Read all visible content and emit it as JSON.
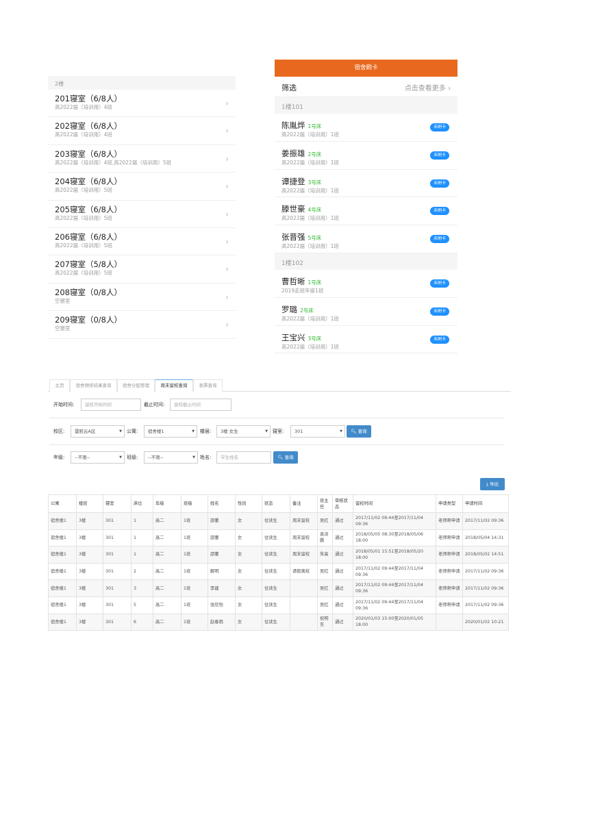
{
  "room_list": {
    "floor": "2楼",
    "rooms": [
      {
        "name": "201寝室（6/8人）",
        "sub": "高2022届（培训用）4班"
      },
      {
        "name": "202寝室（6/8人）",
        "sub": "高2022届（培训用）4班"
      },
      {
        "name": "203寝室（6/8人）",
        "sub": "高2022届（培训用）4班,高2022届（培训用）5班"
      },
      {
        "name": "204寝室（6/8人）",
        "sub": "高2022届（培训用）5班"
      },
      {
        "name": "205寝室（6/8人）",
        "sub": "高2022届（培训用）5班"
      },
      {
        "name": "206寝室（6/8人）",
        "sub": "高2022届（培训用）5班"
      },
      {
        "name": "207寝室（5/8人）",
        "sub": "高2022届（培训用）5班"
      },
      {
        "name": "208寝室（0/8人）",
        "sub": "空寝室"
      },
      {
        "name": "209寝室（0/8人）",
        "sub": "空寝室"
      }
    ]
  },
  "checkin": {
    "title": "宿舍刷卡",
    "filter_label": "筛选",
    "filter_more": "点击查看更多 ›",
    "groups": [
      {
        "name": "1楼101",
        "students": [
          {
            "name": "陈胤烨",
            "bed": "1号床",
            "sub": "高2022届（培训用）1班",
            "status": "未刷卡"
          },
          {
            "name": "姜振雄",
            "bed": "2号床",
            "sub": "高2022届（培训用）1班",
            "status": "未刷卡"
          },
          {
            "name": "谭捷登",
            "bed": "3号床",
            "sub": "高2022届（培训用）1班",
            "status": "未刷卡"
          },
          {
            "name": "滕世豪",
            "bed": "4号床",
            "sub": "高2022届（培训用）1班",
            "status": "未刷卡"
          },
          {
            "name": "张晋强",
            "bed": "5号床",
            "sub": "高2022届（培训用）1班",
            "status": "未刷卡"
          }
        ]
      },
      {
        "name": "1楼102",
        "students": [
          {
            "name": "曹哲晰",
            "bed": "1号床",
            "sub": "2019走班年级1班",
            "status": "未刷卡"
          },
          {
            "name": "罗璐",
            "bed": "2号床",
            "sub": "高2022届（培训用）1班",
            "status": "未刷卡"
          },
          {
            "name": "王宝兴",
            "bed": "3号床",
            "sub": "高2022届（培训用）1班",
            "status": "未刷卡"
          }
        ]
      }
    ]
  },
  "admin": {
    "tabs": [
      "主页",
      "宿舍预排结果查询",
      "宿舍分配管理",
      "周末留校查询",
      "表票查询"
    ],
    "active_tab": 3,
    "start_label": "开始时间:",
    "start_placeholder": "留校开始时间",
    "end_label": "截止时间:",
    "end_placeholder": "留校截止时间",
    "campus_label": "校区:",
    "campus_value": "雷鲛云A区",
    "apartment_label": "公寓:",
    "apartment_value": "宿舍楼1",
    "floor_label": "楼层:",
    "floor_value": "3楼 女生",
    "room_label": "寝室:",
    "room_value": "301",
    "query_label": "查询",
    "grade_label": "年级:",
    "grade_value": "--不限--",
    "class_label": "班级:",
    "class_value": "--不限--",
    "name_label": "姓名:",
    "name_placeholder": "学生姓名",
    "export_label": "导出",
    "table": {
      "headers": [
        "公寓",
        "楼层",
        "寝室",
        "床位",
        "年级",
        "班级",
        "姓名",
        "性别",
        "状态",
        "备注",
        "班主任",
        "审核状态",
        "留校时间",
        "申请类型",
        "申请时间"
      ],
      "rows": [
        [
          "宿舍楼1",
          "3楼",
          "301",
          "1",
          "高二",
          "1班",
          "邵董",
          "女",
          "住读生",
          "周末留校",
          "吴红",
          "通过",
          "2017/11/02 09:44至2017/11/04 09:36",
          "老师帮申请",
          "2017/11/02 09:36"
        ],
        [
          "宿舍楼1",
          "3楼",
          "301",
          "1",
          "高二",
          "1班",
          "邵董",
          "女",
          "住读生",
          "周末留校",
          "袁泽鹏",
          "通过",
          "2018/05/05 08:30至2018/05/06 18:00",
          "老师帮申请",
          "2018/05/04 14:31"
        ],
        [
          "宿舍楼1",
          "3楼",
          "301",
          "1",
          "高二",
          "1班",
          "邵董",
          "女",
          "住读生",
          "周末留校",
          "朱高",
          "通过",
          "2018/05/01 15:51至2018/05/20 18:00",
          "老师帮申请",
          "2018/05/02 14:51"
        ],
        [
          "宿舍楼1",
          "3楼",
          "301",
          "2",
          "高二",
          "1班",
          "解明",
          "女",
          "住读生",
          "请假离校",
          "吴红",
          "通过",
          "2017/11/02 09:44至2017/11/04 09:36",
          "老师帮申请",
          "2017/11/02 09:36"
        ],
        [
          "宿舍楼1",
          "3楼",
          "301",
          "3",
          "高二",
          "1班",
          "李建",
          "女",
          "住读生",
          "",
          "吴红",
          "通过",
          "2017/11/02 09:44至2017/11/04 09:36",
          "老师帮申请",
          "2017/11/02 09:36"
        ],
        [
          "宿舍楼1",
          "3楼",
          "301",
          "5",
          "高二",
          "1班",
          "张欣怡",
          "女",
          "住读生",
          "",
          "吴红",
          "通过",
          "2017/11/02 09:44至2017/11/04 09:36",
          "老师帮申请",
          "2017/11/02 09:36"
        ],
        [
          "宿舍楼1",
          "3楼",
          "301",
          "6",
          "高二",
          "1班",
          "赵春雨",
          "女",
          "住读生",
          "",
          "祝明东",
          "通过",
          "2020/01/03 15:00至2020/01/05 18:00",
          "",
          "2020/01/02 10:21"
        ]
      ]
    }
  }
}
